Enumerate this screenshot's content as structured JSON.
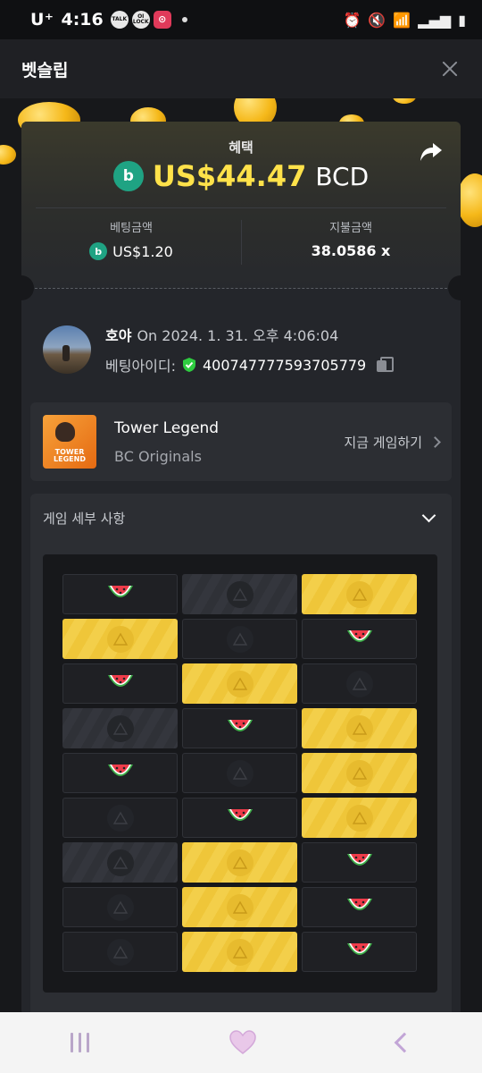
{
  "status_bar": {
    "carrier": "U⁺",
    "time": "4:16",
    "notifications": [
      "TALK",
      "OI LOCK",
      "⊙"
    ],
    "right_icons": [
      "alarm-icon",
      "mute-icon",
      "wifi-icon",
      "signal-icon",
      "battery-icon"
    ]
  },
  "header": {
    "title": "벳슬립"
  },
  "slip": {
    "profit_label": "혜택",
    "profit_amount": "US$44.47",
    "profit_currency": "BCD",
    "bet_amount_label": "베팅금액",
    "bet_amount": "US$1.20",
    "payout_label": "지불금액",
    "payout": "38.0586 x"
  },
  "player": {
    "name": "호야",
    "datetime": "On 2024. 1. 31. 오후 4:06:04",
    "bet_id_label": "베팅아이디:",
    "bet_id": "400747777593705779"
  },
  "game": {
    "thumb_text": "TOWER LEGEND",
    "name": "Tower Legend",
    "provider": "BC Originals",
    "play_label": "지금 게임하기"
  },
  "details": {
    "title": "게임 세부 사항"
  },
  "board": {
    "columns": 3,
    "rows": [
      [
        "watermelon",
        "gray",
        "gold"
      ],
      [
        "gold",
        "dark",
        "watermelon"
      ],
      [
        "watermelon",
        "gold",
        "dark"
      ],
      [
        "gray",
        "watermelon",
        "gold"
      ],
      [
        "watermelon",
        "dark",
        "gold"
      ],
      [
        "dark",
        "watermelon",
        "gold"
      ],
      [
        "gray",
        "gold",
        "watermelon"
      ],
      [
        "dark",
        "gold",
        "watermelon"
      ],
      [
        "dark",
        "gold",
        "watermelon"
      ]
    ]
  },
  "colors": {
    "accent_yellow": "#ffe24a",
    "bc_green": "#1fa383",
    "tile_gold": "#efc639"
  }
}
